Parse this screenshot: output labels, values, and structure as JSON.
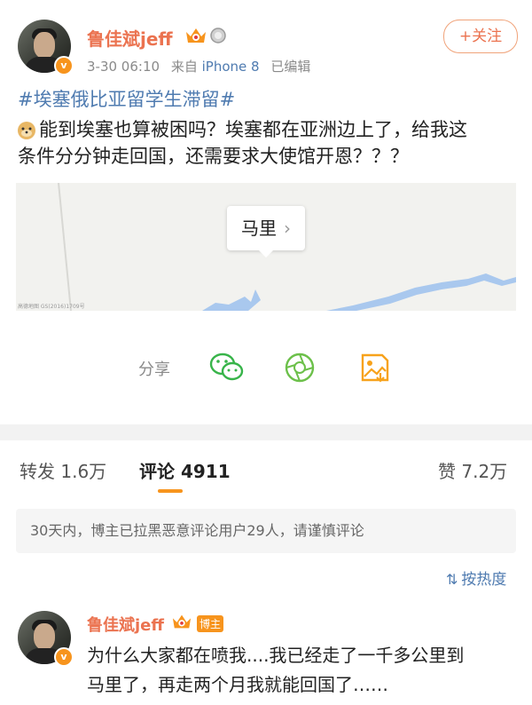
{
  "post": {
    "author": "鲁佳斌jeff",
    "time": "3-30 06:10",
    "source_prefix": "来自",
    "source": "iPhone 8",
    "edited": "已编辑",
    "follow_label": "+关注",
    "hashtag": "#埃塞俄比亚留学生滞留#",
    "text_line1": "能到埃塞也算被困吗？埃塞都在亚洲边上了，给我这",
    "text_line2": "条件分分钟走回国，还需要求大使馆开恩？？？",
    "map": {
      "place": "马里",
      "attribution": "高德地图 GS(2016)1709号"
    }
  },
  "share": {
    "label": "分享",
    "targets": [
      "wechat-icon",
      "moments-icon",
      "save-image-icon"
    ]
  },
  "tabs": {
    "repost": "转发 1.6万",
    "comments": "评论 4911",
    "likes": "赞 7.2万"
  },
  "notice": "30天内，博主已拉黑恶意评论用户29人，请谨慎评论",
  "sort_label": "按热度",
  "comment": {
    "author": "鲁佳斌jeff",
    "tag": "博主",
    "line1": "为什么大家都在喷我....我已经走了一千多公里到",
    "line2": "马里了，再走两个月我就能回国了……"
  },
  "colors": {
    "username": "#eb7350",
    "link": "#4f7bb0",
    "accent": "#f7941d",
    "wechat_green": "#38b44a"
  }
}
